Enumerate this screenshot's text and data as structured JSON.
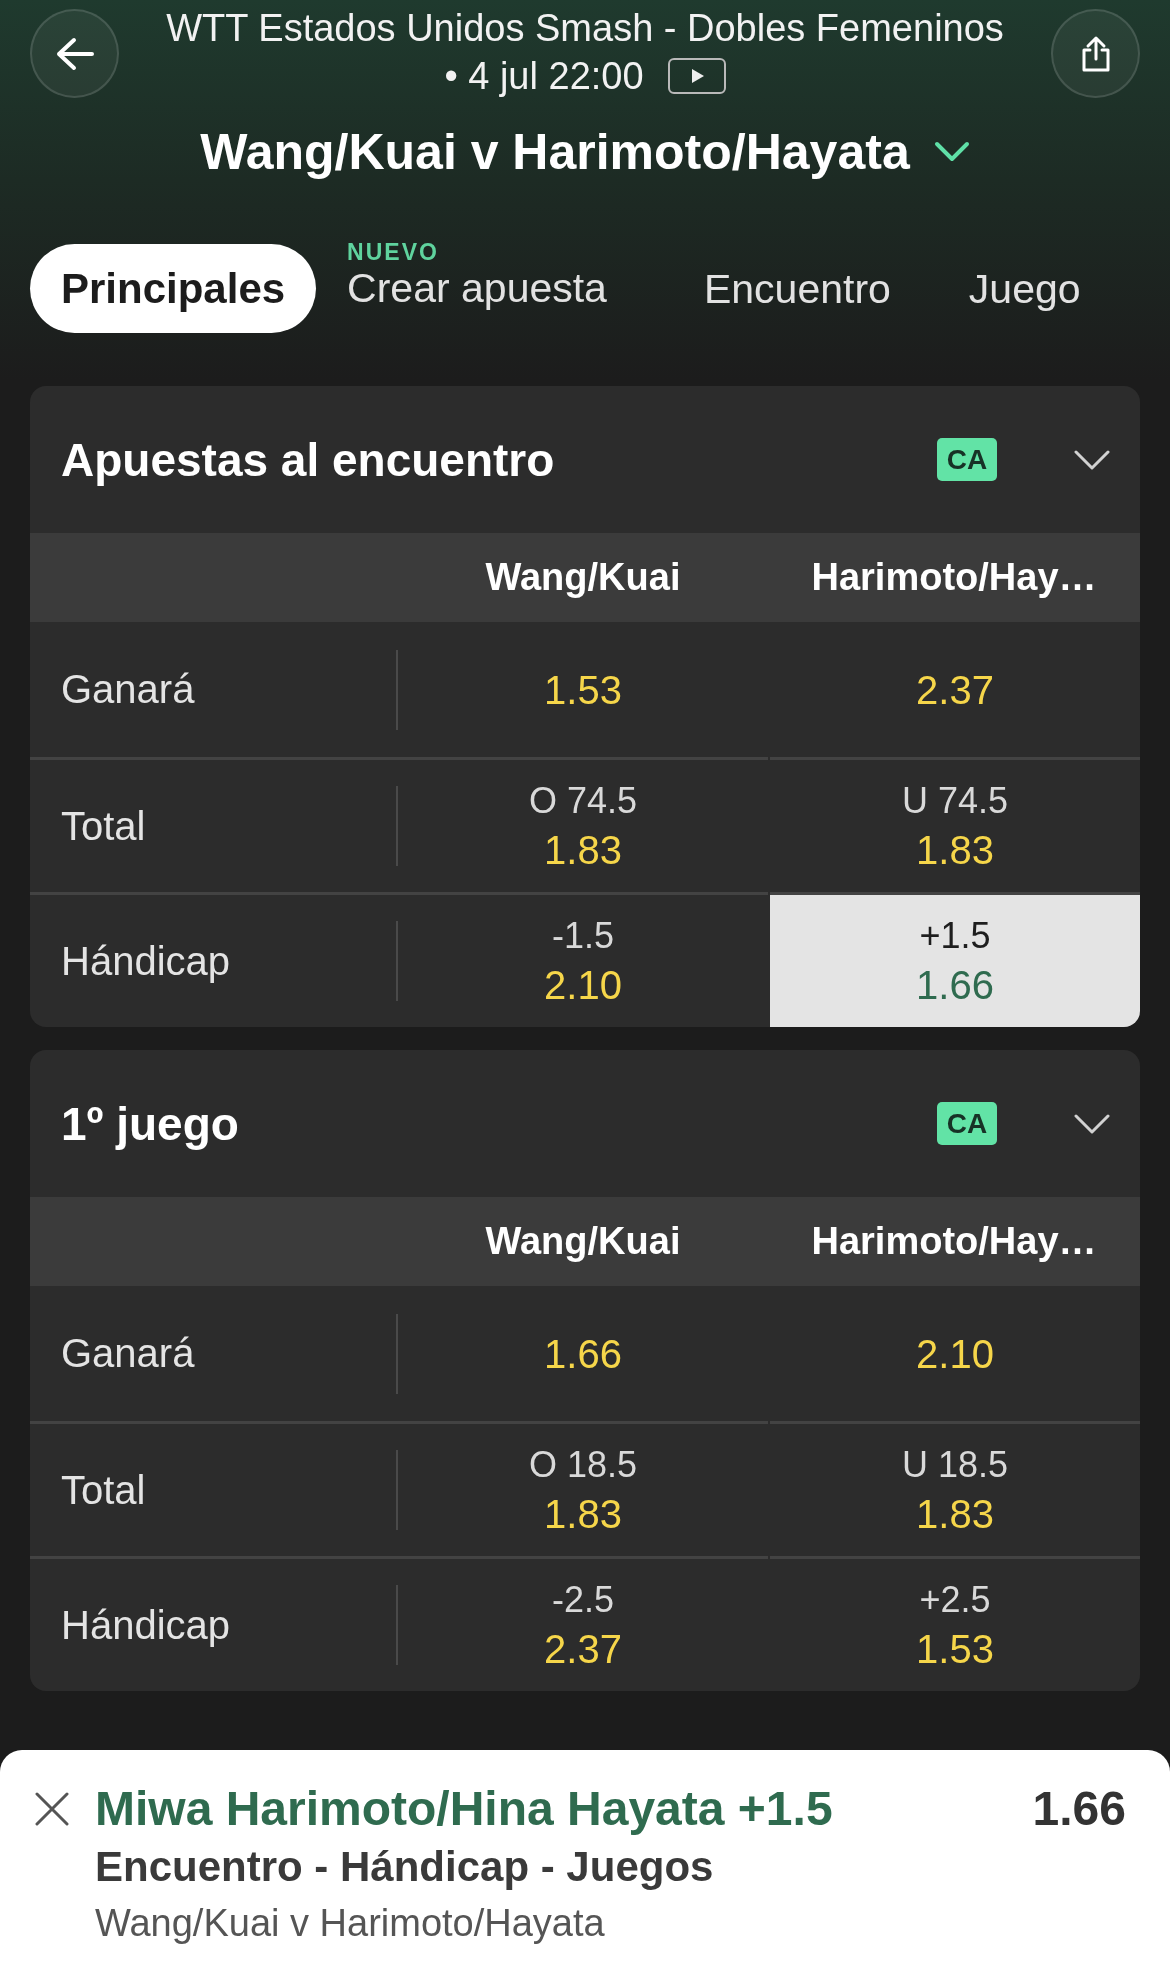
{
  "header": {
    "competition": "WTT Estados Unidos Smash - Dobles Femeninos",
    "start": "• 4 jul 22:00",
    "match": "Wang/Kuai v Harimoto/Hayata"
  },
  "tabs": [
    {
      "label": "Principales",
      "selected": true
    },
    {
      "label": "Crear apuesta",
      "badge": "NUEVO",
      "selected": false
    },
    {
      "label": "Encuentro",
      "selected": false
    },
    {
      "label": "Juego",
      "selected": false
    }
  ],
  "markets": [
    {
      "title": "Apuestas al encuentro",
      "tag": "CA",
      "columns": [
        "Wang/Kuai",
        "Harimoto/Hay…"
      ],
      "rows": [
        {
          "label": "Ganará",
          "outcomes": [
            {
              "odds": "1.53",
              "selected": false
            },
            {
              "odds": "2.37",
              "selected": false
            }
          ]
        },
        {
          "label": "Total",
          "outcomes": [
            {
              "line": "O 74.5",
              "odds": "1.83",
              "selected": false
            },
            {
              "line": "U 74.5",
              "odds": "1.83",
              "selected": false
            }
          ]
        },
        {
          "label": "Hándicap",
          "outcomes": [
            {
              "line": "-1.5",
              "odds": "2.10",
              "selected": false
            },
            {
              "line": "+1.5",
              "odds": "1.66",
              "selected": true
            }
          ]
        }
      ]
    },
    {
      "title": "1º juego",
      "tag": "CA",
      "columns": [
        "Wang/Kuai",
        "Harimoto/Hay…"
      ],
      "rows": [
        {
          "label": "Ganará",
          "outcomes": [
            {
              "odds": "1.66",
              "selected": false
            },
            {
              "odds": "2.10",
              "selected": false
            }
          ]
        },
        {
          "label": "Total",
          "outcomes": [
            {
              "line": "O 18.5",
              "odds": "1.83",
              "selected": false
            },
            {
              "line": "U 18.5",
              "odds": "1.83",
              "selected": false
            }
          ]
        },
        {
          "label": "Hándicap",
          "outcomes": [
            {
              "line": "-2.5",
              "odds": "2.37",
              "selected": false
            },
            {
              "line": "+2.5",
              "odds": "1.53",
              "selected": false
            }
          ]
        }
      ]
    }
  ],
  "bet_slip": {
    "selection": "Miwa Harimoto/Hina Hayata +1.5",
    "odds": "1.66",
    "market": "Encuentro - Hándicap - Juegos",
    "event": "Wang/Kuai v Harimoto/Hayata"
  }
}
